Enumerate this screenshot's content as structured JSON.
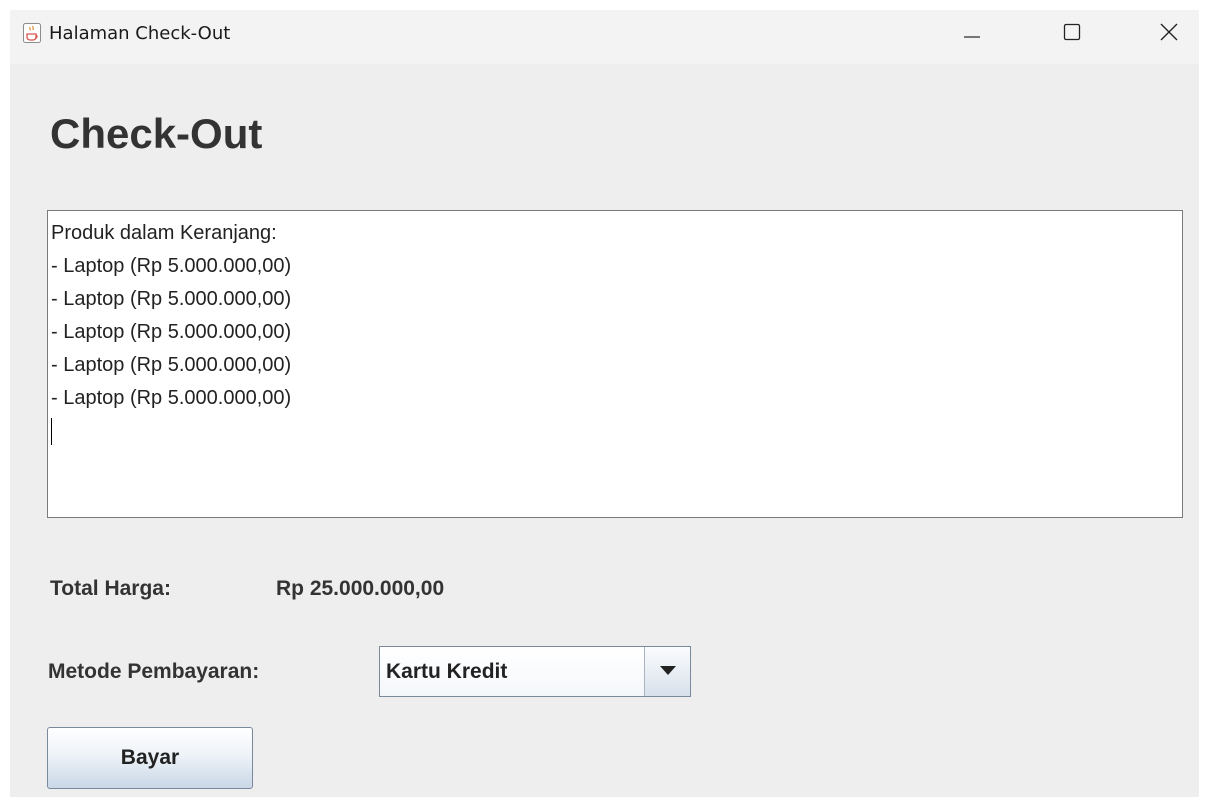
{
  "window": {
    "title": "Halaman Check-Out",
    "app_icon": "java-cup-icon",
    "controls": [
      "minimize-icon",
      "maximize-icon",
      "close-icon"
    ]
  },
  "main": {
    "heading": "Check-Out",
    "cart": {
      "lines": [
        "Produk dalam Keranjang:",
        "- Laptop (Rp 5.000.000,00)",
        "- Laptop (Rp 5.000.000,00)",
        "- Laptop (Rp 5.000.000,00)",
        "- Laptop (Rp 5.000.000,00)",
        "- Laptop (Rp 5.000.000,00)"
      ]
    },
    "total": {
      "label": "Total Harga:",
      "value": "Rp 25.000.000,00"
    },
    "payment": {
      "label": "Metode Pembayaran:",
      "selected": "Kartu Kredit",
      "arrow_icon": "triangle-down-icon"
    },
    "pay_button_label": "Bayar"
  },
  "colors": {
    "window_bg": "#eeeeee",
    "titlebar_bg": "#f3f3f3",
    "text": "#333333",
    "button_gradient_end": "#c9d7e6"
  }
}
